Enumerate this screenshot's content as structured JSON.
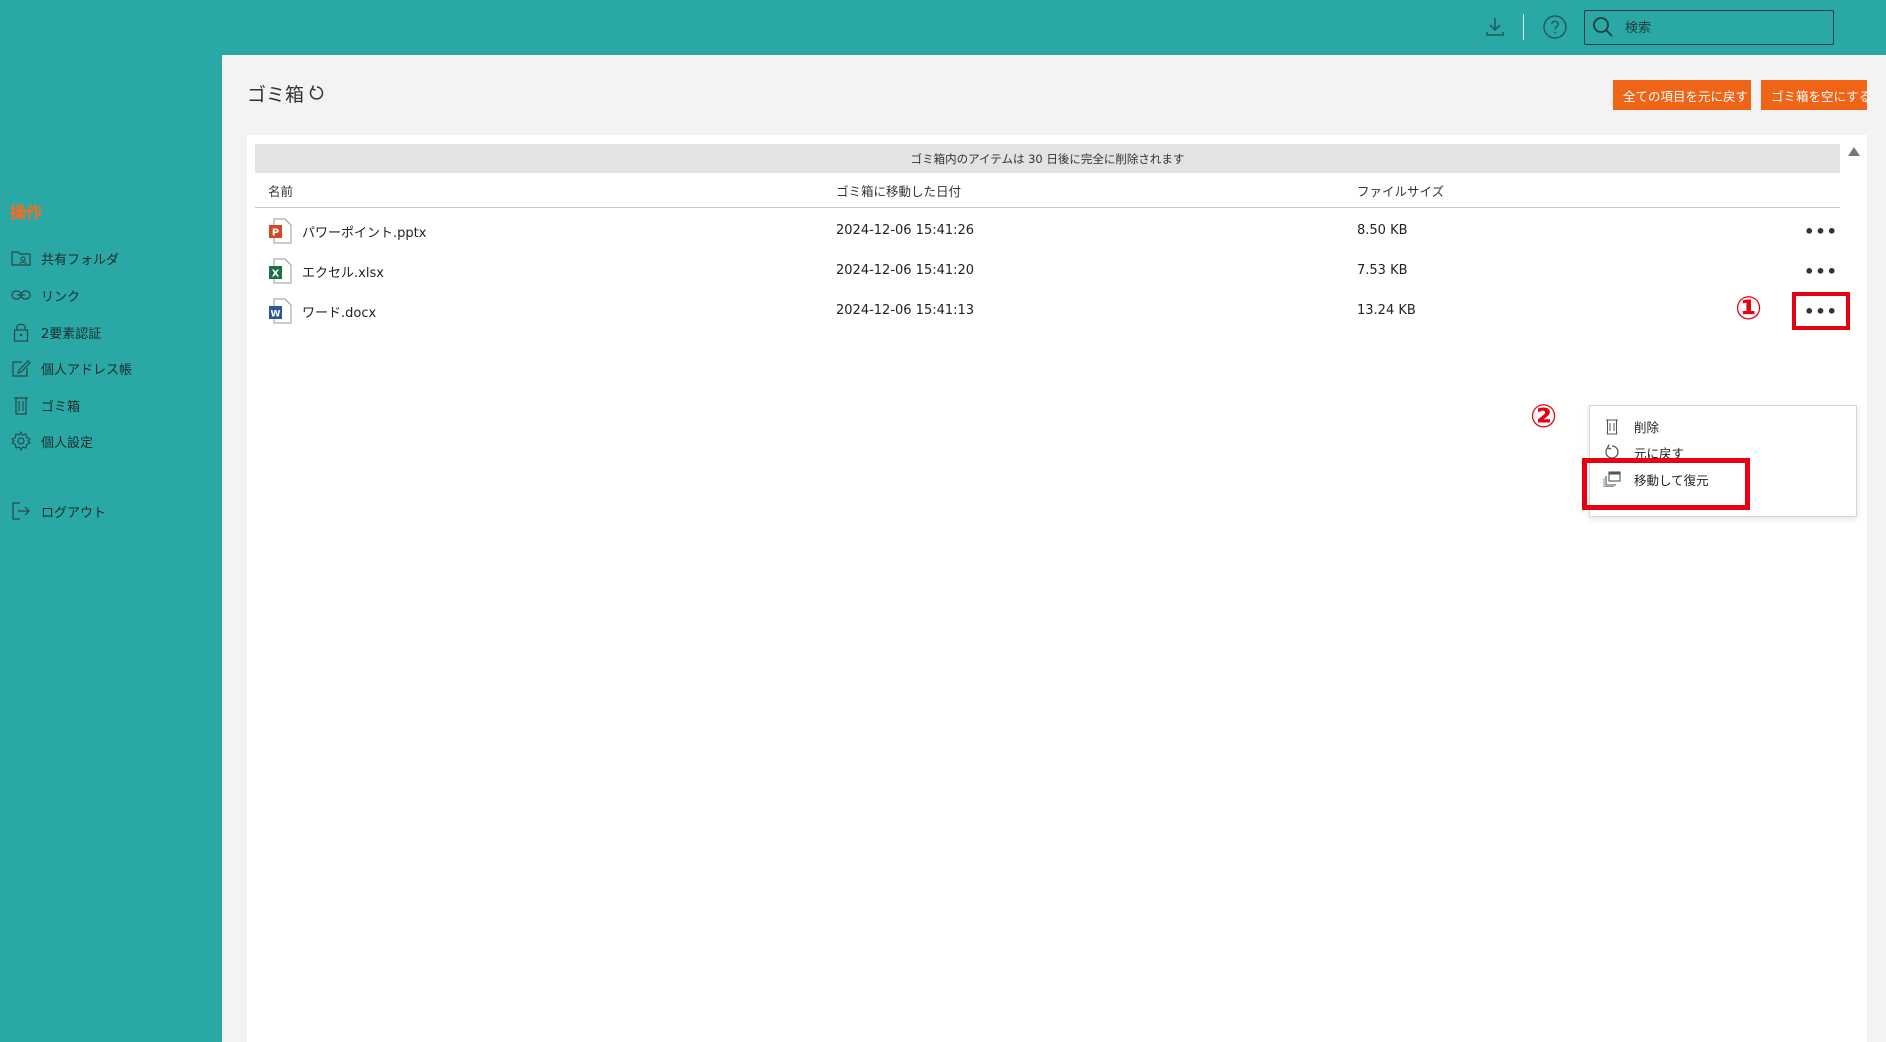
{
  "topbar": {
    "download_icon": "download-icon",
    "help_icon": "help-circle-icon",
    "search": {
      "icon": "search-icon",
      "value": "",
      "placeholder": "検索"
    }
  },
  "sidebar": {
    "heading": "操作",
    "items": [
      {
        "label": "共有フォルダ",
        "icon": "shared-folder-icon"
      },
      {
        "label": "リンク",
        "icon": "link-icon"
      },
      {
        "label": "2要素認証",
        "icon": "lock-icon"
      },
      {
        "label": "個人アドレス帳",
        "icon": "edit-note-icon"
      },
      {
        "label": "ゴミ箱",
        "icon": "trash-icon"
      },
      {
        "label": "個人設定",
        "icon": "gear-icon"
      }
    ],
    "logout": {
      "label": "ログアウト",
      "icon": "logout-icon"
    }
  },
  "main": {
    "title": "ゴミ箱",
    "refresh_icon": "refresh-icon",
    "restore_all_label": "全ての項目を元に戻す",
    "empty_trash_label": "ゴミ箱を空にする",
    "notice": "ゴミ箱内のアイテムは 30 日後に完全に削除されます",
    "columns": {
      "name": "名前",
      "deleted_date": "ゴミ箱に移動した日付",
      "size": "ファイルサイズ"
    },
    "rows": [
      {
        "name": "パワーポイント.pptx",
        "date": "2024-12-06 15:41:26",
        "size": "8.50 KB",
        "icon": "powerpoint-file-icon",
        "more": "•••"
      },
      {
        "name": "エクセル.xlsx",
        "date": "2024-12-06 15:41:20",
        "size": "7.53 KB",
        "icon": "excel-file-icon",
        "more": "•••"
      },
      {
        "name": "ワード.docx",
        "date": "2024-12-06 15:41:13",
        "size": "13.24 KB",
        "icon": "word-file-icon",
        "more": "•••"
      }
    ]
  },
  "context_menu": {
    "items": [
      {
        "label": "削除",
        "icon": "trash-icon"
      },
      {
        "label": "元に戻す",
        "icon": "undo-icon"
      },
      {
        "label": "移動して復元",
        "icon": "move-restore-icon"
      }
    ]
  },
  "annotations": {
    "step1": "①",
    "step2": "②"
  },
  "colors": {
    "teal": "#29a8a6",
    "orange": "#f06417",
    "highlight_red": "#e60012",
    "sidebar_heading": "#ff6a1a"
  }
}
